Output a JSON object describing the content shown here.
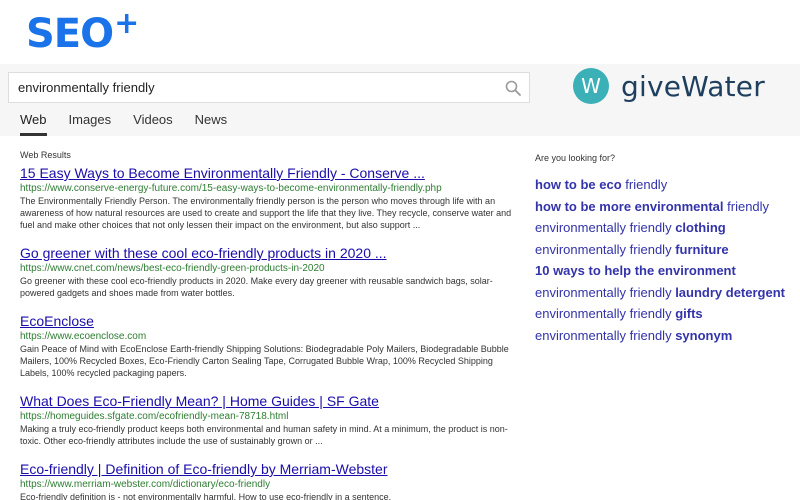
{
  "brand": {
    "logo_text": "SEO",
    "logo_plus": "+",
    "partner_logo_letter": "W",
    "partner_logo_text": "giveWater"
  },
  "search": {
    "value": "environmentally friendly",
    "placeholder": ""
  },
  "tabs": [
    {
      "label": "Web",
      "active": true
    },
    {
      "label": "Images",
      "active": false
    },
    {
      "label": "Videos",
      "active": false
    },
    {
      "label": "News",
      "active": false
    }
  ],
  "results_heading": "Web Results",
  "results": [
    {
      "title": "15 Easy Ways to Become Environmentally Friendly - Conserve ...",
      "url": "https://www.conserve-energy-future.com/15-easy-ways-to-become-environmentally-friendly.php",
      "snippet": "The Environmentally Friendly Person. The environmentally friendly person is the person who moves through life with an awareness of how natural resources are used to create and support the life that they live. They recycle, conserve water and fuel and make other choices that not only lessen their impact on the environment, but also support ..."
    },
    {
      "title": "Go greener with these cool eco-friendly products in 2020 ...",
      "url": "https://www.cnet.com/news/best-eco-friendly-green-products-in-2020",
      "snippet": "Go greener with these cool eco-friendly products in 2020. Make every day greener with reusable sandwich bags, solar-powered gadgets and shoes made from water bottles."
    },
    {
      "title": "EcoEnclose",
      "url": "https://www.ecoenclose.com",
      "snippet": "Gain Peace of Mind with EcoEnclose Earth-friendly Shipping Solutions: Biodegradable Poly Mailers, Biodegradable Bubble Mailers, 100% Recycled Boxes, Eco-Friendly Carton Sealing Tape, Corrugated Bubble Wrap, 100% Recycled Shipping Labels, 100% recycled packaging papers."
    },
    {
      "title": "What Does Eco-Friendly Mean? | Home Guides | SF Gate",
      "url": "https://homeguides.sfgate.com/ecofriendly-mean-78718.html",
      "snippet": "Making a truly eco-friendly product keeps both environmental and human safety in mind. At a minimum, the product is non-toxic. Other eco-friendly attributes include the use of sustainably grown or ..."
    },
    {
      "title": "Eco-friendly | Definition of Eco-friendly by Merriam-Webster",
      "url": "https://www.merriam-webster.com/dictionary/eco-friendly",
      "snippet": "Eco-friendly definition is - not environmentally harmful. How to use eco-friendly in a sentence."
    }
  ],
  "suggest_heading": "Are you looking for?",
  "suggestions": [
    {
      "bold": "how to be eco",
      "normal": " friendly",
      "bold_first": true
    },
    {
      "bold": "how to be more environmental",
      "normal": " friendly",
      "bold_first": true
    },
    {
      "normal": "environmentally friendly ",
      "bold": "clothing",
      "bold_first": false
    },
    {
      "normal": "environmentally friendly ",
      "bold": "furniture",
      "bold_first": false
    },
    {
      "bold": "10 ways to help the environment",
      "normal": "",
      "bold_first": true
    },
    {
      "normal": "environmentally friendly ",
      "bold": "laundry detergent",
      "bold_first": false
    },
    {
      "normal": "environmentally friendly ",
      "bold": "gifts",
      "bold_first": false
    },
    {
      "normal": "environmentally friendly ",
      "bold": "synonym",
      "bold_first": false
    }
  ],
  "colors": {
    "brand_blue": "#1a73e8",
    "link": "#1a0dab",
    "url_green": "#2e7d32",
    "suggest_blue": "#3333aa",
    "givewater_teal": "#3bb0b7"
  }
}
